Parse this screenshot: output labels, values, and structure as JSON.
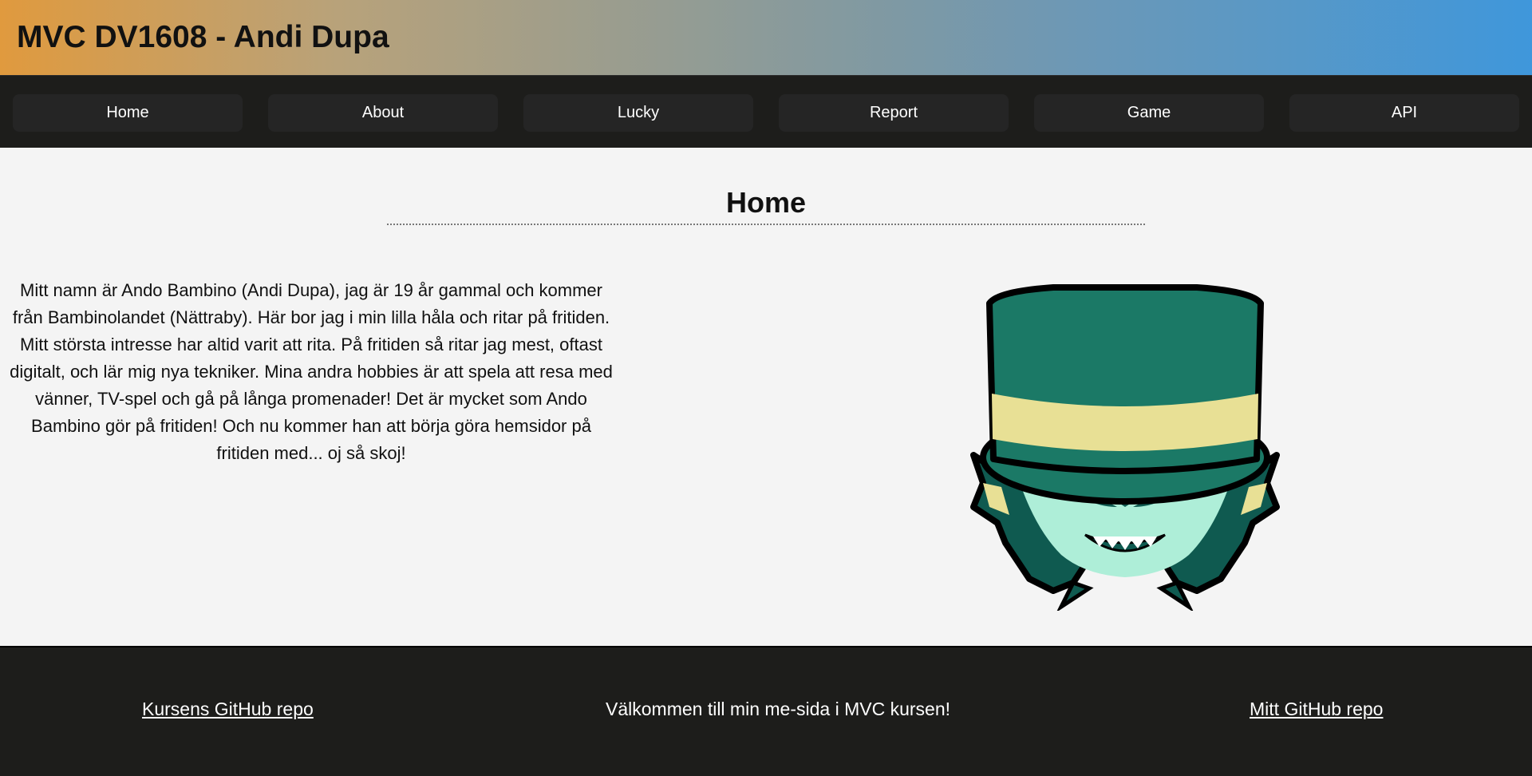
{
  "header": {
    "title": "MVC DV1608 - Andi Dupa"
  },
  "nav": {
    "items": [
      {
        "label": "Home"
      },
      {
        "label": "About"
      },
      {
        "label": "Lucky"
      },
      {
        "label": "Report"
      },
      {
        "label": "Game"
      },
      {
        "label": "API"
      }
    ]
  },
  "main": {
    "heading": "Home",
    "intro": "Mitt namn är Ando Bambino (Andi Dupa), jag är 19 år gammal och kommer från Bambinolandet (Nättraby). Här bor jag i min lilla håla och ritar på fritiden. Mitt största intresse har altid varit att rita. På fritiden så ritar jag mest, oftast digitalt, och lär mig nya tekniker. Mina andra hobbies är att spela att resa med vänner, TV-spel och gå på långa promenader! Det är mycket som Ando Bambino gör på fritiden! Och nu kommer han att börja göra hemsidor på fritiden med... oj så skoj!",
    "image": {
      "icon": "top-hat-character-icon"
    }
  },
  "footer": {
    "course_repo": "Kursens GitHub repo",
    "welcome": "Välkommen till min me-sida i MVC kursen!",
    "my_repo": "Mitt GitHub repo"
  },
  "colors": {
    "hat_green": "#1b7966",
    "hat_band": "#e8e095",
    "face_mint": "#aeeed8",
    "hair_dark": "#0f5a50",
    "nav_bg": "#1d1d1b"
  }
}
